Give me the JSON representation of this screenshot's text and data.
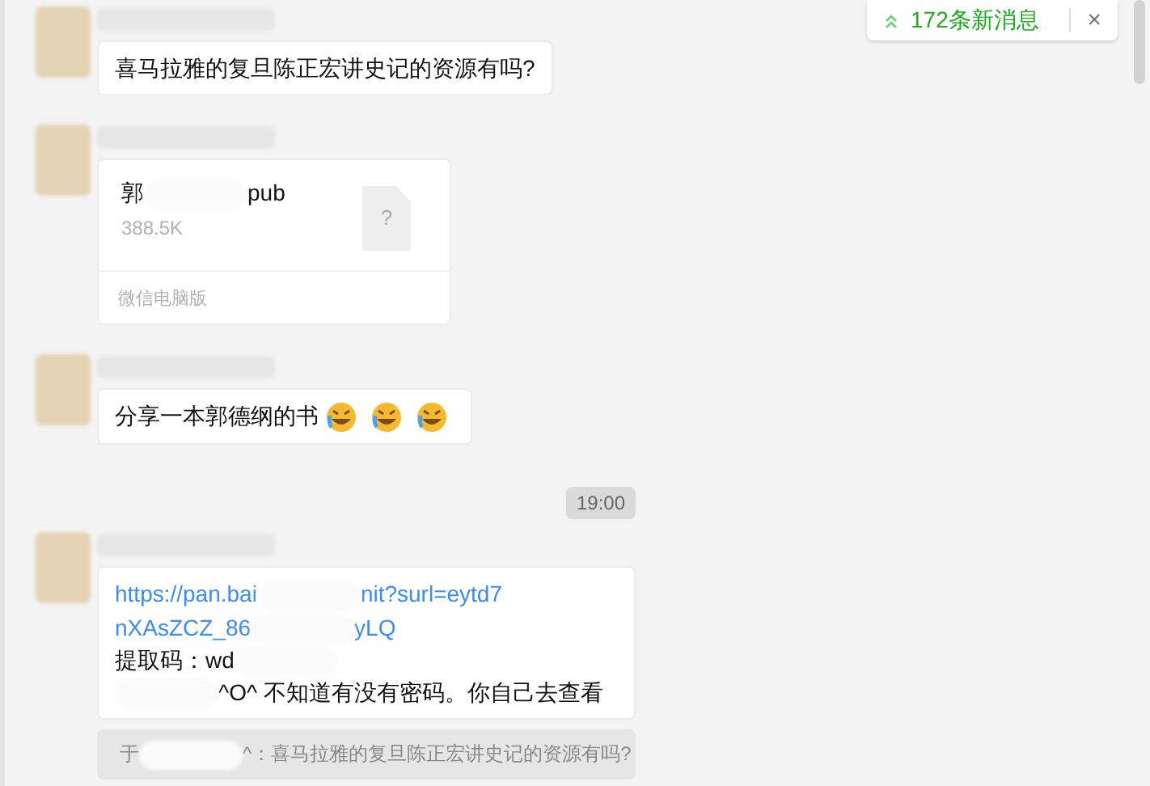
{
  "new_messages": {
    "label": "172条新消息",
    "close": "×"
  },
  "messages": [
    {
      "kind": "text",
      "lines": [
        [
          {
            "kind": "text",
            "text": "喜马拉雅的复旦陈正宏讲史记的资源有吗?"
          }
        ]
      ]
    },
    {
      "kind": "file",
      "name": [
        {
          "kind": "text",
          "text": "郭"
        },
        {
          "kind": "redacted"
        },
        {
          "kind": "text",
          "text": "pub"
        }
      ],
      "size": "388.5K",
      "file_icon": "?",
      "source": "微信电脑版"
    },
    {
      "kind": "text",
      "lines": [
        [
          {
            "kind": "text",
            "text": "分享一本郭德纲的书"
          },
          {
            "kind": "emoji"
          },
          {
            "kind": "emoji"
          },
          {
            "kind": "emoji"
          }
        ]
      ]
    },
    {
      "kind": "time",
      "text": "19:00"
    },
    {
      "kind": "text",
      "lines": [
        [
          {
            "kind": "link",
            "text": "https://pan.bai"
          },
          {
            "kind": "redacted"
          },
          {
            "kind": "link",
            "text": "nit?surl=eytd7"
          }
        ],
        [
          {
            "kind": "link",
            "text": "nXAsZCZ_86"
          },
          {
            "kind": "redacted"
          },
          {
            "kind": "link",
            "text": "yLQ"
          }
        ],
        [
          {
            "kind": "text",
            "text": "提取码：wd"
          },
          {
            "kind": "redacted"
          }
        ],
        [
          {
            "kind": "redacted"
          },
          {
            "kind": "text",
            "text": "^O^ 不知道有没有密码。你自己去查看"
          }
        ]
      ],
      "quote": [
        {
          "kind": "text",
          "text": "于"
        },
        {
          "kind": "redacted"
        },
        {
          "kind": "text",
          "text": "^：喜马拉雅的复旦陈正宏讲史记的资源有吗?"
        }
      ]
    }
  ]
}
